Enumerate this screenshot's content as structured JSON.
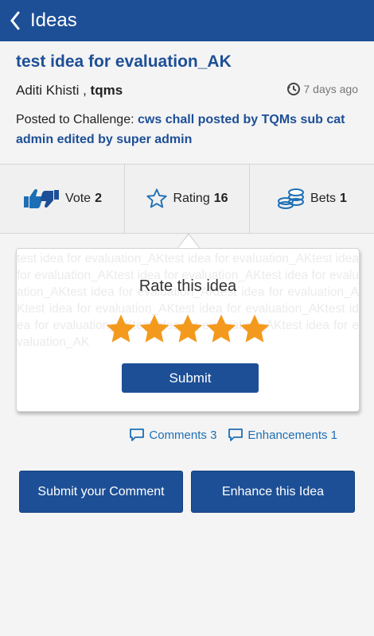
{
  "appbar": {
    "title": "Ideas"
  },
  "idea": {
    "title": "test idea for evaluation_AK",
    "author_name": "Aditi Khisti ,",
    "author_group": "tqms",
    "time_ago": "7 days ago",
    "posted_label": "Posted to Challenge:",
    "challenge": "cws chall posted by TQMs sub cat admin edited by super admin",
    "description": "test idea for evaluation_AKtest idea for evaluation_AKtest idea for evaluation_AKtest idea for evaluation_AKtest idea for evaluation_AKtest idea for evaluation_AKtest idea for evaluation_AKtest idea for evaluation_AKtest idea for evaluation_AKtest idea for evaluation_AKtest idea for evaluation_AKtest idea for evaluation_AK"
  },
  "stats": {
    "vote_label": "Vote",
    "vote_count": "2",
    "rating_label": "Rating",
    "rating_count": "16",
    "bets_label": "Bets",
    "bets_count": "1"
  },
  "rating_popup": {
    "title": "Rate this idea",
    "stars_selected": 5,
    "stars_total": 5,
    "submit_label": "Submit"
  },
  "links": {
    "comments": "Comments 3",
    "enhancements": "Enhancements 1"
  },
  "buttons": {
    "submit_comment": "Submit your Comment",
    "enhance": "Enhance this Idea"
  },
  "colors": {
    "brand": "#1d4f96",
    "link": "#1d6fb5",
    "star": "#f39a1e"
  }
}
